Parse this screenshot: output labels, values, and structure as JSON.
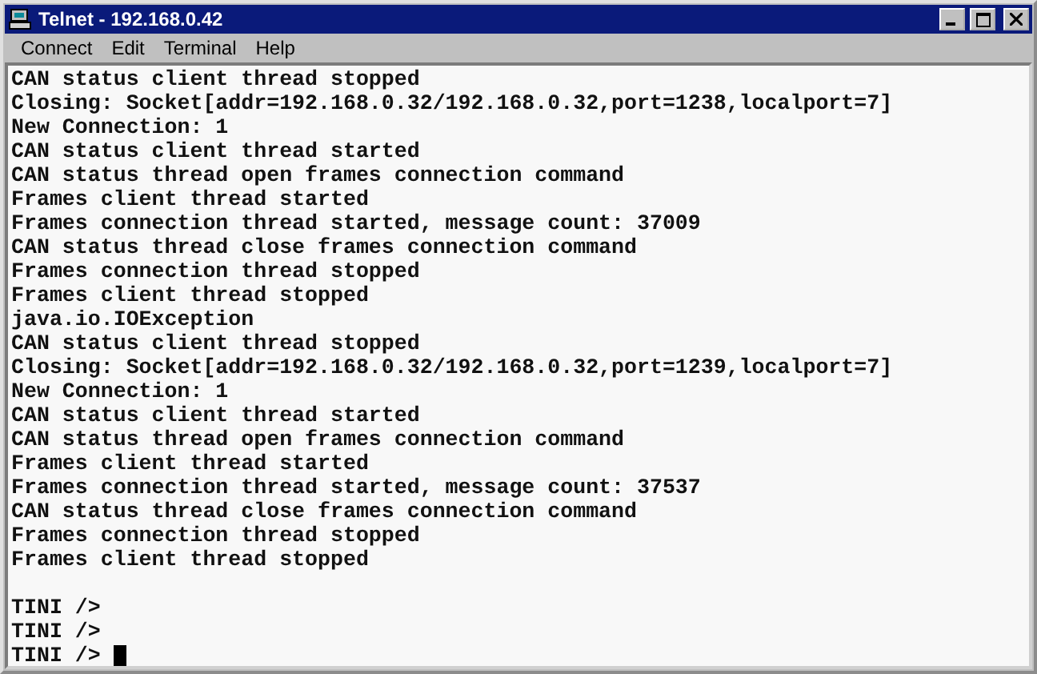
{
  "window": {
    "title": "Telnet - 192.168.0.42"
  },
  "menu": [
    "Connect",
    "Edit",
    "Terminal",
    "Help"
  ],
  "output": [
    "CAN status client thread stopped",
    "Closing: Socket[addr=192.168.0.32/192.168.0.32,port=1238,localport=7]",
    "New Connection: 1",
    "CAN status client thread started",
    "CAN status thread open frames connection command",
    "Frames client thread started",
    "Frames connection thread started, message count: 37009",
    "CAN status thread close frames connection command",
    "Frames connection thread stopped",
    "Frames client thread stopped",
    "java.io.IOException",
    "CAN status client thread stopped",
    "Closing: Socket[addr=192.168.0.32/192.168.0.32,port=1239,localport=7]",
    "New Connection: 1",
    "CAN status client thread started",
    "CAN status thread open frames connection command",
    "Frames client thread started",
    "Frames connection thread started, message count: 37537",
    "CAN status thread close frames connection command",
    "Frames connection thread stopped",
    "Frames client thread stopped"
  ],
  "prompts": [
    {
      "text": "TINI />",
      "cursor": false
    },
    {
      "text": "TINI />",
      "cursor": false
    },
    {
      "text": "TINI />",
      "cursor": true
    }
  ]
}
